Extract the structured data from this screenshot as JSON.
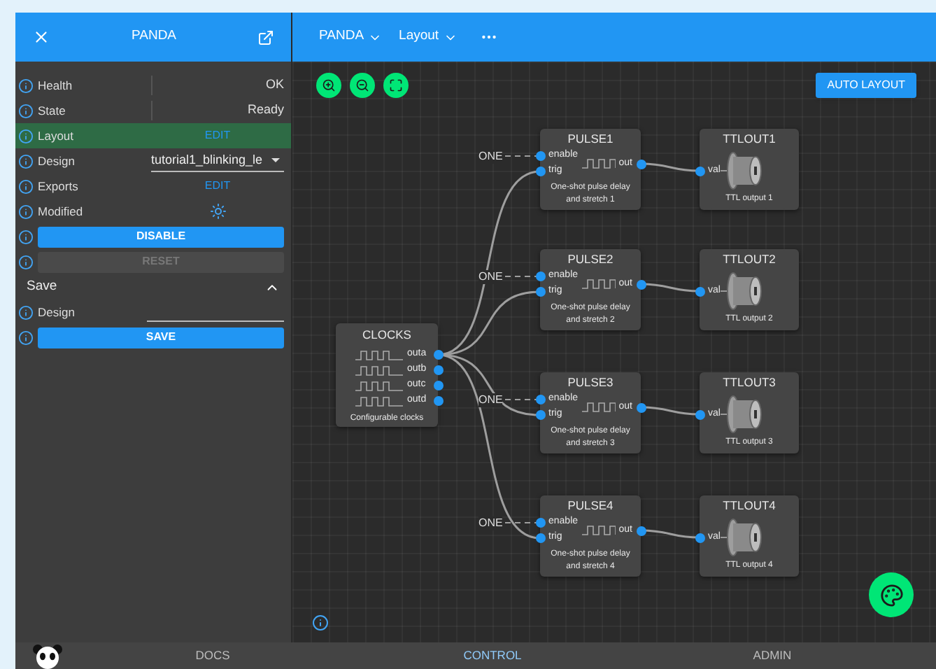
{
  "sidebar": {
    "title": "PANDA",
    "rows": [
      {
        "kind": "value",
        "label": "Health",
        "value": "OK",
        "highlighted": false
      },
      {
        "kind": "value",
        "label": "State",
        "value": "Ready",
        "highlighted": false
      },
      {
        "kind": "action",
        "label": "Layout",
        "action": "EDIT",
        "highlighted": true
      },
      {
        "kind": "select",
        "label": "Design",
        "value": "tutorial1_blinking_le",
        "highlighted": false
      },
      {
        "kind": "action",
        "label": "Exports",
        "action": "EDIT",
        "highlighted": false
      },
      {
        "kind": "indicator",
        "label": "Modified",
        "highlighted": false
      },
      {
        "kind": "button",
        "action": "DISABLE",
        "disabled": false,
        "highlighted": false
      },
      {
        "kind": "button",
        "action": "RESET",
        "disabled": true,
        "highlighted": false
      }
    ],
    "section": {
      "title": "Save",
      "expanded": true,
      "rows": [
        {
          "kind": "field",
          "label": "Design",
          "highlighted": false
        },
        {
          "kind": "button",
          "action": "SAVE",
          "disabled": false,
          "highlighted": false
        }
      ]
    }
  },
  "toolbar": {
    "menus": [
      {
        "label": "PANDA"
      },
      {
        "label": "Layout"
      }
    ]
  },
  "canvas": {
    "auto_layout": "AUTO LAYOUT",
    "nodes": [
      {
        "kind": "clock",
        "title": "CLOCKS",
        "outputs": [
          "outa",
          "outb",
          "outc",
          "outd"
        ],
        "caption": [
          "Configurable clocks"
        ]
      },
      {
        "kind": "pulse",
        "title": "PULSE1",
        "inputs": [
          {
            "label": "enable",
            "constant": "ONE"
          },
          {
            "label": "trig"
          }
        ],
        "outputs": [
          "out"
        ],
        "caption": [
          "One-shot pulse delay",
          "and stretch 1"
        ]
      },
      {
        "kind": "ttl",
        "title": "TTLOUT1",
        "inputs": [
          {
            "label": "val"
          }
        ],
        "caption": [
          "TTL output 1"
        ]
      },
      {
        "kind": "pulse",
        "title": "PULSE2",
        "inputs": [
          {
            "label": "enable",
            "constant": "ONE"
          },
          {
            "label": "trig"
          }
        ],
        "outputs": [
          "out"
        ],
        "caption": [
          "One-shot pulse delay",
          "and stretch 2"
        ]
      },
      {
        "kind": "ttl",
        "title": "TTLOUT2",
        "inputs": [
          {
            "label": "val"
          }
        ],
        "caption": [
          "TTL output 2"
        ]
      },
      {
        "kind": "pulse",
        "title": "PULSE3",
        "inputs": [
          {
            "label": "enable",
            "constant": "ONE"
          },
          {
            "label": "trig"
          }
        ],
        "outputs": [
          "out"
        ],
        "caption": [
          "One-shot pulse delay",
          "and stretch 3"
        ]
      },
      {
        "kind": "ttl",
        "title": "TTLOUT3",
        "inputs": [
          {
            "label": "val"
          }
        ],
        "caption": [
          "TTL output 3"
        ]
      },
      {
        "kind": "pulse",
        "title": "PULSE4",
        "inputs": [
          {
            "label": "enable",
            "constant": "ONE"
          },
          {
            "label": "trig"
          }
        ],
        "outputs": [
          "out"
        ],
        "caption": [
          "One-shot pulse delay",
          "and stretch 4"
        ]
      },
      {
        "kind": "ttl",
        "title": "TTLOUT4",
        "inputs": [
          {
            "label": "val"
          }
        ],
        "caption": [
          "TTL output 4"
        ]
      }
    ]
  },
  "bottom_nav": [
    {
      "label": "DOCS",
      "selected": false
    },
    {
      "label": "CONTROL",
      "selected": true
    },
    {
      "label": "ADMIN",
      "selected": false
    }
  ]
}
